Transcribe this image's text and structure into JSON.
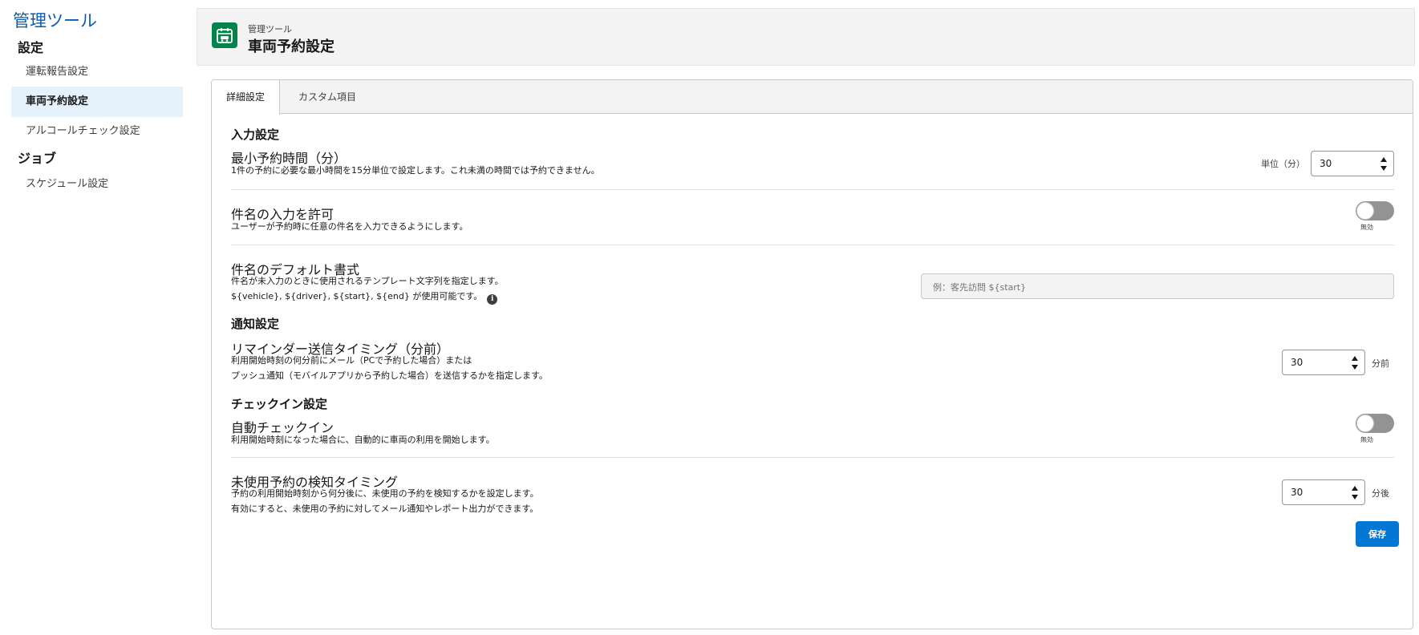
{
  "sidebar": {
    "app_title": "管理ツール",
    "sections": [
      {
        "heading": "設定",
        "items": [
          {
            "label": "運転報告設定"
          },
          {
            "label": "車両予約設定",
            "active": true
          },
          {
            "label": "アルコールチェック設定"
          }
        ]
      },
      {
        "heading": "ジョブ",
        "items": [
          {
            "label": "スケジュール設定"
          }
        ]
      }
    ]
  },
  "header": {
    "icon": "calendar-car-icon",
    "breadcrumb": "管理ツール",
    "title": "車両予約設定"
  },
  "tabs": [
    {
      "label": "詳細設定",
      "active": true
    },
    {
      "label": "カスタム項目",
      "active": false
    }
  ],
  "groups": {
    "input": {
      "heading": "入力設定"
    },
    "notify": {
      "heading": "通知設定"
    },
    "checkin": {
      "heading": "チェックイン設定"
    }
  },
  "settings": {
    "min_time": {
      "title": "最小予約時間（分）",
      "desc": "1件の予約に必要な最小時間を15分単位で設定します。これ未満の時間では予約できません。",
      "unit_prefix": "単位（分）",
      "value": "30"
    },
    "allow_subject": {
      "title": "件名の入力を許可",
      "desc": "ユーザーが予約時に任意の件名を入力できるようにします。",
      "toggle_label": "無効",
      "enabled": false
    },
    "subject_format": {
      "title": "件名のデフォルト書式",
      "desc_line1": "件名が未入力のときに使用されるテンプレート文字列を指定します。",
      "desc_line2": "${vehicle}, ${driver}, ${start}, ${end} が使用可能です。",
      "placeholder": "例：客先訪問 ${start}"
    },
    "reminder": {
      "title": "リマインダー送信タイミング（分前）",
      "desc_line1": "利用開始時刻の何分前にメール（PCで予約した場合）または",
      "desc_line2": "プッシュ通知（モバイルアプリから予約した場合）を送信するかを指定します。",
      "value": "30",
      "unit_suffix": "分前"
    },
    "auto_checkin": {
      "title": "自動チェックイン",
      "desc": "利用開始時刻になった場合に、自動的に車両の利用を開始します。",
      "toggle_label": "無効",
      "enabled": false
    },
    "unused_detect": {
      "title": "未使用予約の検知タイミング",
      "desc_line1": "予約の利用開始時刻から何分後に、未使用の予約を検知するかを設定します。",
      "desc_line2": "有効にすると、未使用の予約に対してメール通知やレポート出力ができます。",
      "value": "30",
      "unit_suffix": "分後"
    }
  },
  "actions": {
    "save_label": "保存"
  },
  "colors": {
    "brand": "#0b5cab",
    "primary_button": "#0176d3",
    "header_icon": "#04844b",
    "active_nav": "#e5f1fb"
  }
}
